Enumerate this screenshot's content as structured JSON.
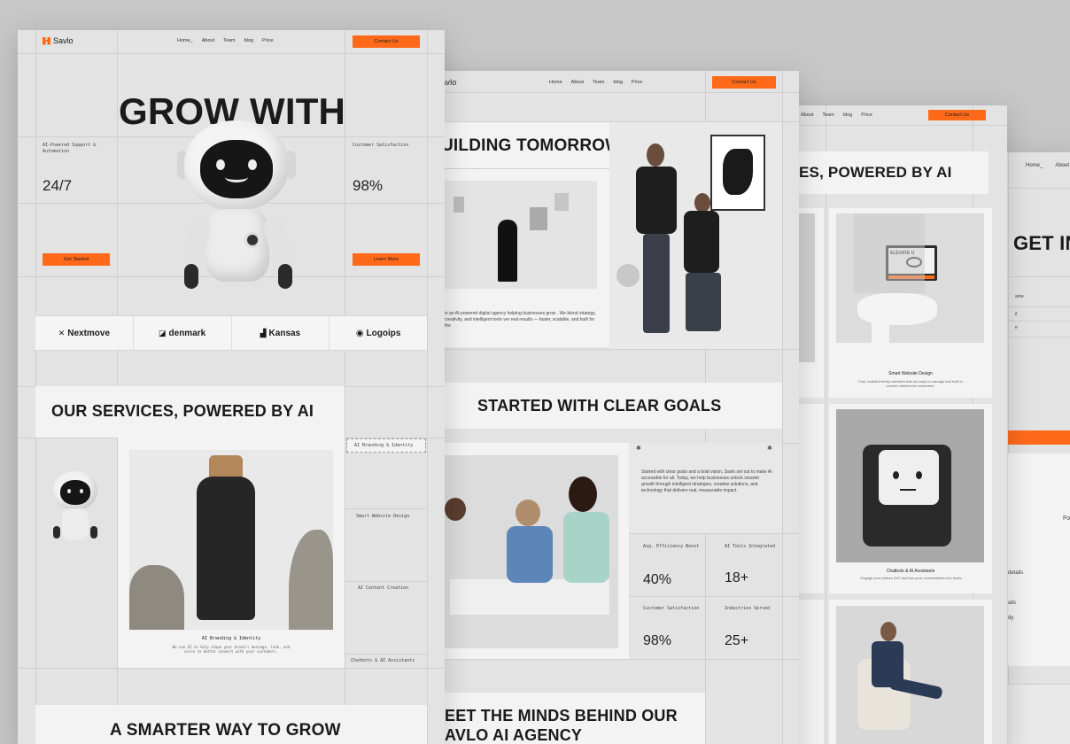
{
  "brand": {
    "name": "Savlo",
    "accent": "#ff6a1a",
    "logo_icon": "grid-logo-icon"
  },
  "nav": {
    "home": "Home",
    "home_short": "Home_",
    "about": "About",
    "team": "Team",
    "blog": "blog",
    "price": "Price",
    "contact": "Contact Us"
  },
  "page1": {
    "hero_title": "GROW WITH",
    "left_stat_label": "AI-Powered Support & Automation",
    "left_stat_value": "24/7",
    "right_stat_label": "Customer Satisfaction",
    "right_stat_value": "98%",
    "get_started": "Get Started",
    "learn_more": "Learn More",
    "logos": [
      "Nextmove",
      "denmark",
      "Kansas",
      "Logoips"
    ],
    "services_title": "OUR SERVICES, POWERED BY AI",
    "services": [
      "AI Branding & Identity",
      "Smart Website Design",
      "AI Content Creation",
      "Chatbots & AI Assistants"
    ],
    "featured_service_title": "AI Branding & Identity",
    "featured_service_desc": "We use AI to help shape your brand's message, look, and voice to better connect with your customers.",
    "bottom_title": "A SMARTER WAY TO GROW"
  },
  "page2": {
    "hero_title": "UILDING TOMORROW",
    "intro": "is an AI-powered digital agency helping businesses grow . We blend strategy, creativity, and intelligent tools ver real results — faster, scalable, and built for the",
    "goals_title": "STARTED WITH CLEAR GOALS",
    "goals_text": "Started with clear goals and a bold vision, Savlo set out to make AI accessible for all. Today, we help businesses unlock smarter growth through intelligent strategies, creative solutions, and technology that delivers real, measurable impact.",
    "stats": [
      {
        "label": "Avg. Efficiency Boost",
        "value": "40%"
      },
      {
        "label": "AI Tools Integrated",
        "value": "18+"
      },
      {
        "label": "Customer Satisfaction",
        "value": "98%"
      },
      {
        "label": "Industries Served",
        "value": "25+"
      }
    ],
    "team_title_1": "EET THE MINDS BEHIND OUR",
    "team_title_2": "AVLO AI AGENCY"
  },
  "page3": {
    "title": "ES, POWERED BY AI",
    "card1_title": "Smart Website Design",
    "card1_desc": "Fast, mobile-friendly websites that are easy to manage and built to convert visitors into customers.",
    "laptop_text": "ELEVATE U",
    "card2_title": "Chatbots & AI Assistants",
    "card2_desc": "Engage your visitors 24/7 and turn your conversations into leads."
  },
  "page4": {
    "title": "GET IN",
    "field1": "ame",
    "field2": "il",
    "field3": "e",
    "side_text": "Fo",
    "line1": "details",
    "line2": "ails",
    "line3": "dy"
  }
}
